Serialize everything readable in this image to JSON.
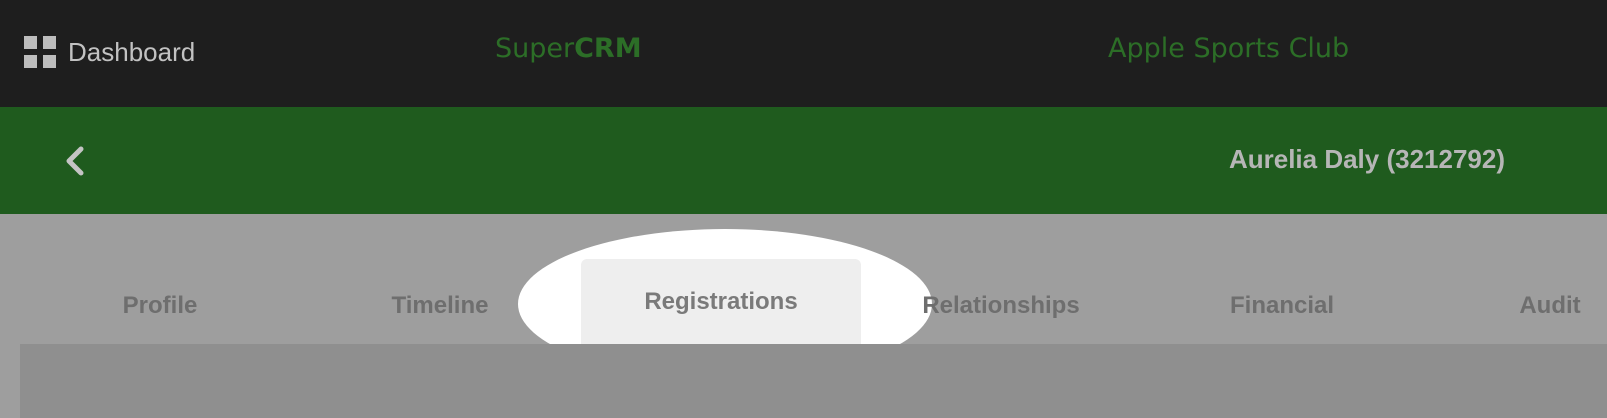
{
  "header": {
    "dashboard_label": "Dashboard",
    "brand_prefix": "Super",
    "brand_bold": "CRM",
    "club_name": "Apple Sports Club"
  },
  "member_bar": {
    "member_name": "Aurelia Daly (3212792)"
  },
  "tabs": [
    {
      "label": "Profile"
    },
    {
      "label": "Timeline"
    },
    {
      "label": "Registrations",
      "active": true
    },
    {
      "label": "Relationships"
    },
    {
      "label": "Financial"
    },
    {
      "label": "Audit"
    }
  ],
  "colors": {
    "topbar": "#1e1e1e",
    "brand_green": "#2c6e27",
    "member_bar": "#1f5b1e",
    "tab_area": "#9e9e9e",
    "active_tab": "#eeeeee"
  }
}
